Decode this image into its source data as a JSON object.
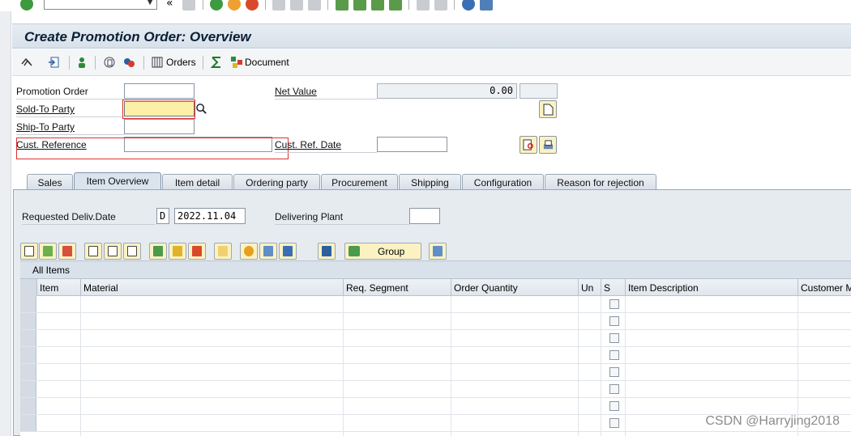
{
  "window": {
    "title": "Create Promotion Order: Overview"
  },
  "app_toolbar": {
    "orders_label": "Orders",
    "document_label": "Document"
  },
  "header": {
    "promotion_order_label": "Promotion Order",
    "promotion_order_value": "",
    "sold_to_label": "Sold-To Party",
    "sold_to_value": "",
    "ship_to_label": "Ship-To Party",
    "ship_to_value": "",
    "cust_ref_label": "Cust. Reference",
    "cust_ref_value": "",
    "net_value_label": "Net Value",
    "net_value": "0.00",
    "currency": "",
    "cust_ref_date_label": "Cust. Ref. Date",
    "cust_ref_date_value": ""
  },
  "tabs": [
    {
      "label": "Sales"
    },
    {
      "label": "Item Overview"
    },
    {
      "label": "Item detail"
    },
    {
      "label": "Ordering party"
    },
    {
      "label": "Procurement"
    },
    {
      "label": "Shipping"
    },
    {
      "label": "Configuration"
    },
    {
      "label": "Reason for rejection"
    }
  ],
  "active_tab": "Item Overview",
  "item_overview": {
    "req_deliv_label": "Requested Deliv.Date",
    "req_deliv_type": "D",
    "req_deliv_date": "2022.11.04",
    "delivering_plant_label": "Delivering Plant",
    "delivering_plant_value": "",
    "group_button_label": "Group",
    "table_title": "All Items",
    "columns": [
      "Item",
      "Material",
      "Req. Segment",
      "Order Quantity",
      "Un",
      "S",
      "Item Description",
      "Customer M"
    ]
  },
  "watermark": "CSDN @Harryjing2018"
}
